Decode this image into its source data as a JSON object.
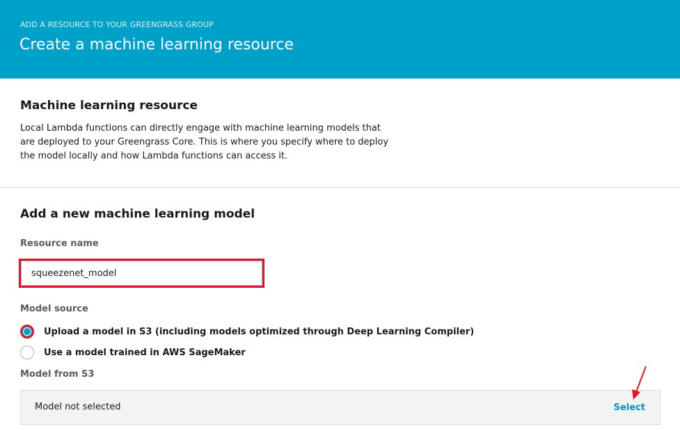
{
  "header": {
    "eyebrow": "ADD A RESOURCE TO YOUR GREENGRASS GROUP",
    "title": "Create a machine learning resource",
    "background": "#00a1c9"
  },
  "section_resource": {
    "title": "Machine learning resource",
    "description": "Local Lambda functions can directly engage with machine learning models that are deployed to your Greengrass Core. This is where you specify where to deploy the model locally and how Lambda functions can access it."
  },
  "section_new_model": {
    "title": "Add a new machine learning model",
    "resource_name": {
      "label": "Resource name",
      "value": "squeezenet_model"
    },
    "model_source": {
      "label": "Model source",
      "options": [
        {
          "label": "Upload a model in S3 (including models optimized through Deep Learning Compiler)",
          "selected": true
        },
        {
          "label": "Use a model trained in AWS SageMaker",
          "selected": false
        }
      ]
    },
    "model_from_s3": {
      "label": "Model from S3",
      "status": "Model not selected",
      "select_label": "Select"
    }
  },
  "annotations": {
    "highlight_color": "#e0142b",
    "arrow_icon": "red-arrow-icon"
  }
}
